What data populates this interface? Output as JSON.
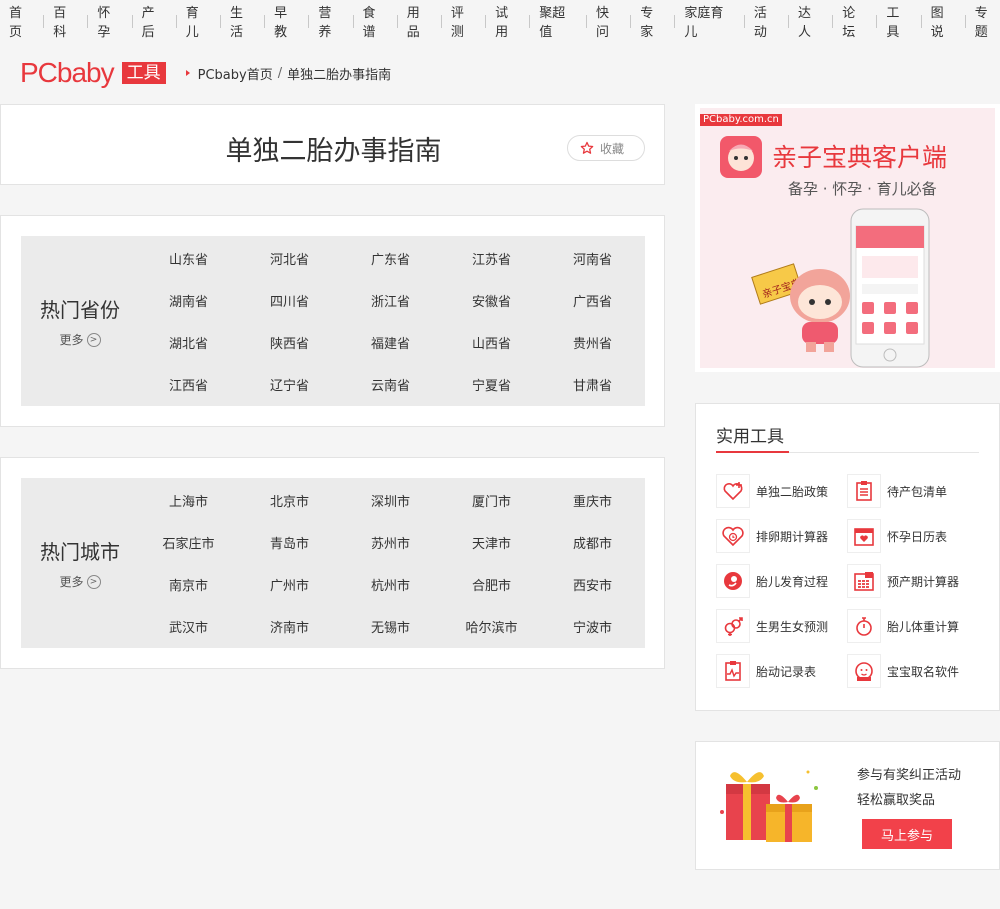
{
  "nav": [
    "首页",
    "百科",
    "怀孕",
    "产后",
    "育儿",
    "生活",
    "早教",
    "营养",
    "食谱",
    "用品",
    "评测",
    "试用",
    "聚超值",
    "快问",
    "专家",
    "家庭育儿",
    "活动",
    "达人",
    "论坛",
    "工具",
    "图说",
    "专题"
  ],
  "header": {
    "logo": "PCbaby",
    "logo_tag": "工具",
    "breadcrumb_home": "PCbaby首页",
    "breadcrumb_sep": "/",
    "breadcrumb_current": "单独二胎办事指南"
  },
  "main": {
    "title": "单独二胎办事指南",
    "fav_label": "收藏",
    "provinces": {
      "title": "热门省份",
      "more": "更多",
      "items": [
        "山东省",
        "河北省",
        "广东省",
        "江苏省",
        "河南省",
        "湖南省",
        "四川省",
        "浙江省",
        "安徽省",
        "广西省",
        "湖北省",
        "陕西省",
        "福建省",
        "山西省",
        "贵州省",
        "江西省",
        "辽宁省",
        "云南省",
        "宁夏省",
        "甘肃省"
      ]
    },
    "cities": {
      "title": "热门城市",
      "more": "更多",
      "items": [
        "上海市",
        "北京市",
        "深圳市",
        "厦门市",
        "重庆市",
        "石家庄市",
        "青岛市",
        "苏州市",
        "天津市",
        "成都市",
        "南京市",
        "广州市",
        "杭州市",
        "合肥市",
        "西安市",
        "武汉市",
        "济南市",
        "无锡市",
        "哈尔滨市",
        "宁波市"
      ]
    }
  },
  "ad": {
    "tag": "PCbaby.com.cn",
    "headline": "亲子宝典客户端",
    "sub": "备孕 · 怀孕 · 育儿必备",
    "sign": "亲子宝典"
  },
  "tools": {
    "title": "实用工具",
    "items": [
      {
        "label": "单独二胎政策",
        "icon": "heart-plus-icon"
      },
      {
        "label": "待产包清单",
        "icon": "clipboard-list-icon"
      },
      {
        "label": "排卵期计算器",
        "icon": "heart-clock-icon"
      },
      {
        "label": "怀孕日历表",
        "icon": "calendar-heart-icon"
      },
      {
        "label": "胎儿发育过程",
        "icon": "fetus-icon"
      },
      {
        "label": "预产期计算器",
        "icon": "calendar-grid-icon"
      },
      {
        "label": "生男生女预测",
        "icon": "gender-icon"
      },
      {
        "label": "胎儿体重计算",
        "icon": "stopwatch-icon"
      },
      {
        "label": "胎动记录表",
        "icon": "clipboard-pulse-icon"
      },
      {
        "label": "宝宝取名软件",
        "icon": "baby-face-icon"
      }
    ]
  },
  "promo": {
    "line1": "参与有奖纠正活动",
    "line2": "轻松赢取奖品",
    "button": "马上参与"
  },
  "colors": {
    "accent": "#e8383d",
    "panel_bg": "#ebebeb",
    "page_bg": "#f5f5f5"
  }
}
